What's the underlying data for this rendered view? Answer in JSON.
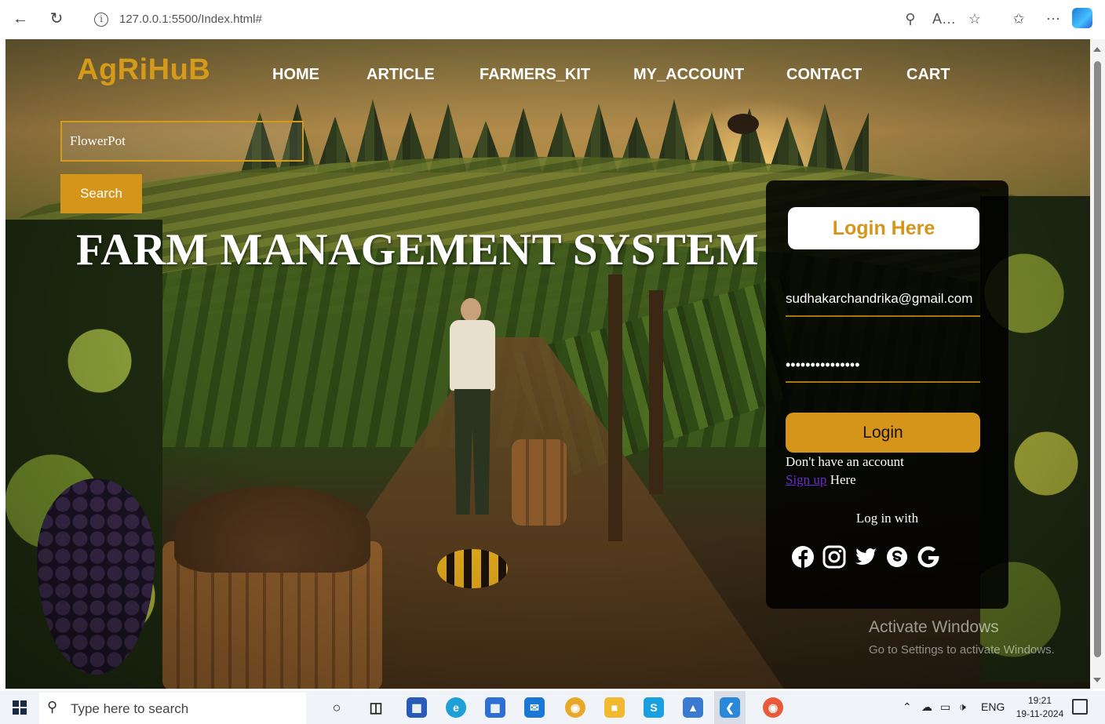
{
  "browser": {
    "url": "127.0.0.1:5500/Index.html#",
    "back_icon": "arrow-left-icon",
    "refresh_icon": "refresh-icon",
    "info_icon": "info-icon"
  },
  "site": {
    "logo": "AgRiHuB",
    "nav": [
      "HOME",
      "ARTICLE",
      "FARMERS_KIT",
      "MY_ACCOUNT",
      "CONTACT",
      "CART"
    ],
    "search": {
      "value": "FlowerPot",
      "button": "Search"
    },
    "hero_title": "FARM MANAGEMENT SYSTEM"
  },
  "login": {
    "header": "Login Here",
    "email": "sudhakarchandrika@gmail.com",
    "password": "•••••••••••••••",
    "button": "Login",
    "no_account": "Don't have an account",
    "signup_link": "Sign up",
    "signup_suffix": " Here",
    "login_with": "Log in with",
    "socials": [
      "facebook-icon",
      "instagram-icon",
      "twitter-icon",
      "skype-icon",
      "google-icon"
    ]
  },
  "watermark": {
    "line1": "Activate Windows",
    "line2": "Go to Settings to activate Windows."
  },
  "taskbar": {
    "search_placeholder": "Type here to search",
    "language": "ENG",
    "time": "19:21",
    "date": "19-11-2024"
  },
  "colors": {
    "accent": "#d4951a",
    "logo": "#d69a1a",
    "panel": "#000000",
    "link": "#6a2ad4"
  }
}
